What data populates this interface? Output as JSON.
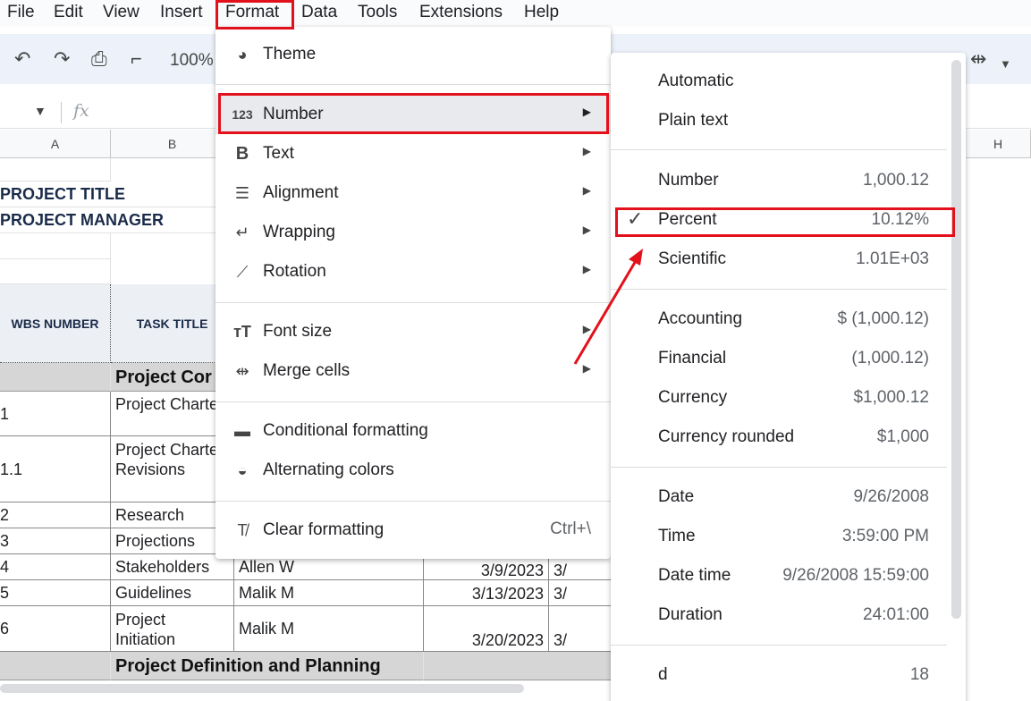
{
  "menubar": [
    "File",
    "Edit",
    "View",
    "Insert",
    "Format",
    "Data",
    "Tools",
    "Extensions",
    "Help"
  ],
  "toolbar": {
    "zoom": "100%"
  },
  "formula_bar": {
    "fx": "fx"
  },
  "columns": {
    "a": "A",
    "b": "B",
    "h": "H"
  },
  "sheet": {
    "project_title": "PROJECT TITLE",
    "project_manager": "PROJECT MANAGER",
    "wbs_header": "WBS NUMBER",
    "task_header": "TASK TITLE",
    "section1": "Project Cor",
    "section2": "Project Definition and Planning",
    "rows": [
      {
        "wbs": "1",
        "task": "Project Charter",
        "owner": "",
        "start": "",
        "end": ""
      },
      {
        "wbs": "1.1",
        "task": "Project Charter Revisions",
        "owner": "",
        "start": "",
        "end": ""
      },
      {
        "wbs": "2",
        "task": "Research",
        "owner": "",
        "start": "",
        "end": ""
      },
      {
        "wbs": "3",
        "task": "Projections",
        "owner": "",
        "start": "",
        "end": ""
      },
      {
        "wbs": "4",
        "task": "Stakeholders",
        "owner": "Allen W",
        "start": "3/9/2023",
        "end": "3/"
      },
      {
        "wbs": "5",
        "task": "Guidelines",
        "owner": "Malik M",
        "start": "3/13/2023",
        "end": "3/"
      },
      {
        "wbs": "6",
        "task": "Project Initiation",
        "owner": "Malik M",
        "start": "3/20/2023",
        "end": "3/"
      }
    ]
  },
  "format_menu": {
    "items": [
      {
        "label": "Theme",
        "icon": "palette-icon"
      },
      {
        "label": "Number",
        "icon": "number-format-icon",
        "submenu": true
      },
      {
        "label": "Text",
        "icon": "bold-icon",
        "submenu": true
      },
      {
        "label": "Alignment",
        "icon": "align-icon",
        "submenu": true
      },
      {
        "label": "Wrapping",
        "icon": "wrap-icon",
        "submenu": true
      },
      {
        "label": "Rotation",
        "icon": "rotation-icon",
        "submenu": true
      },
      {
        "label": "Font size",
        "icon": "font-size-icon",
        "submenu": true
      },
      {
        "label": "Merge cells",
        "icon": "merge-icon",
        "submenu": true
      },
      {
        "label": "Conditional formatting",
        "icon": "paint-roller-icon"
      },
      {
        "label": "Alternating colors",
        "icon": "drop-icon"
      },
      {
        "label": "Clear formatting",
        "icon": "clear-format-icon",
        "shortcut": "Ctrl+\\"
      }
    ]
  },
  "number_submenu": {
    "items": [
      {
        "label": "Automatic",
        "value": ""
      },
      {
        "label": "Plain text",
        "value": ""
      },
      {
        "label": "Number",
        "value": "1,000.12"
      },
      {
        "label": "Percent",
        "value": "10.12%",
        "checked": true
      },
      {
        "label": "Scientific",
        "value": "1.01E+03"
      },
      {
        "label": "Accounting",
        "value": "$ (1,000.12)"
      },
      {
        "label": "Financial",
        "value": "(1,000.12)"
      },
      {
        "label": "Currency",
        "value": "$1,000.12"
      },
      {
        "label": "Currency rounded",
        "value": "$1,000"
      },
      {
        "label": "Date",
        "value": "9/26/2008"
      },
      {
        "label": "Time",
        "value": "3:59:00 PM"
      },
      {
        "label": "Date time",
        "value": "9/26/2008 15:59:00"
      },
      {
        "label": "Duration",
        "value": "24:01:00"
      },
      {
        "label": "d",
        "value": "18"
      }
    ]
  },
  "colors": {
    "highlight": "#e3111b",
    "menu_hover": "#e8eaed"
  }
}
